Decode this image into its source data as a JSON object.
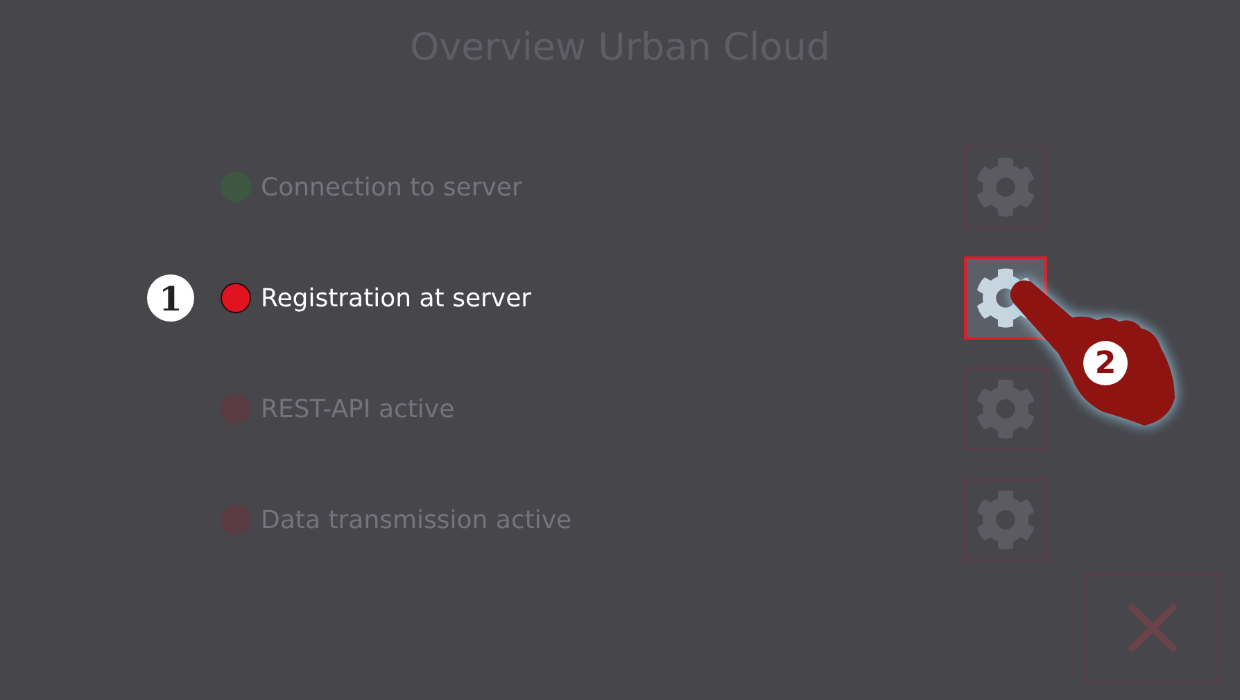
{
  "title": "Overview Urban Cloud",
  "rows": [
    {
      "label": "Connection to server",
      "color": "#3d5840",
      "selected": false
    },
    {
      "label": "Registration at server",
      "color": "#e0141e",
      "selected": true,
      "callout": "1",
      "pointer_callout": "2"
    },
    {
      "label": "REST-API active",
      "color": "#583c42",
      "selected": false
    },
    {
      "label": "Data transmission active",
      "color": "#583c42",
      "selected": false
    }
  ],
  "close_button": {
    "disabled": true
  }
}
